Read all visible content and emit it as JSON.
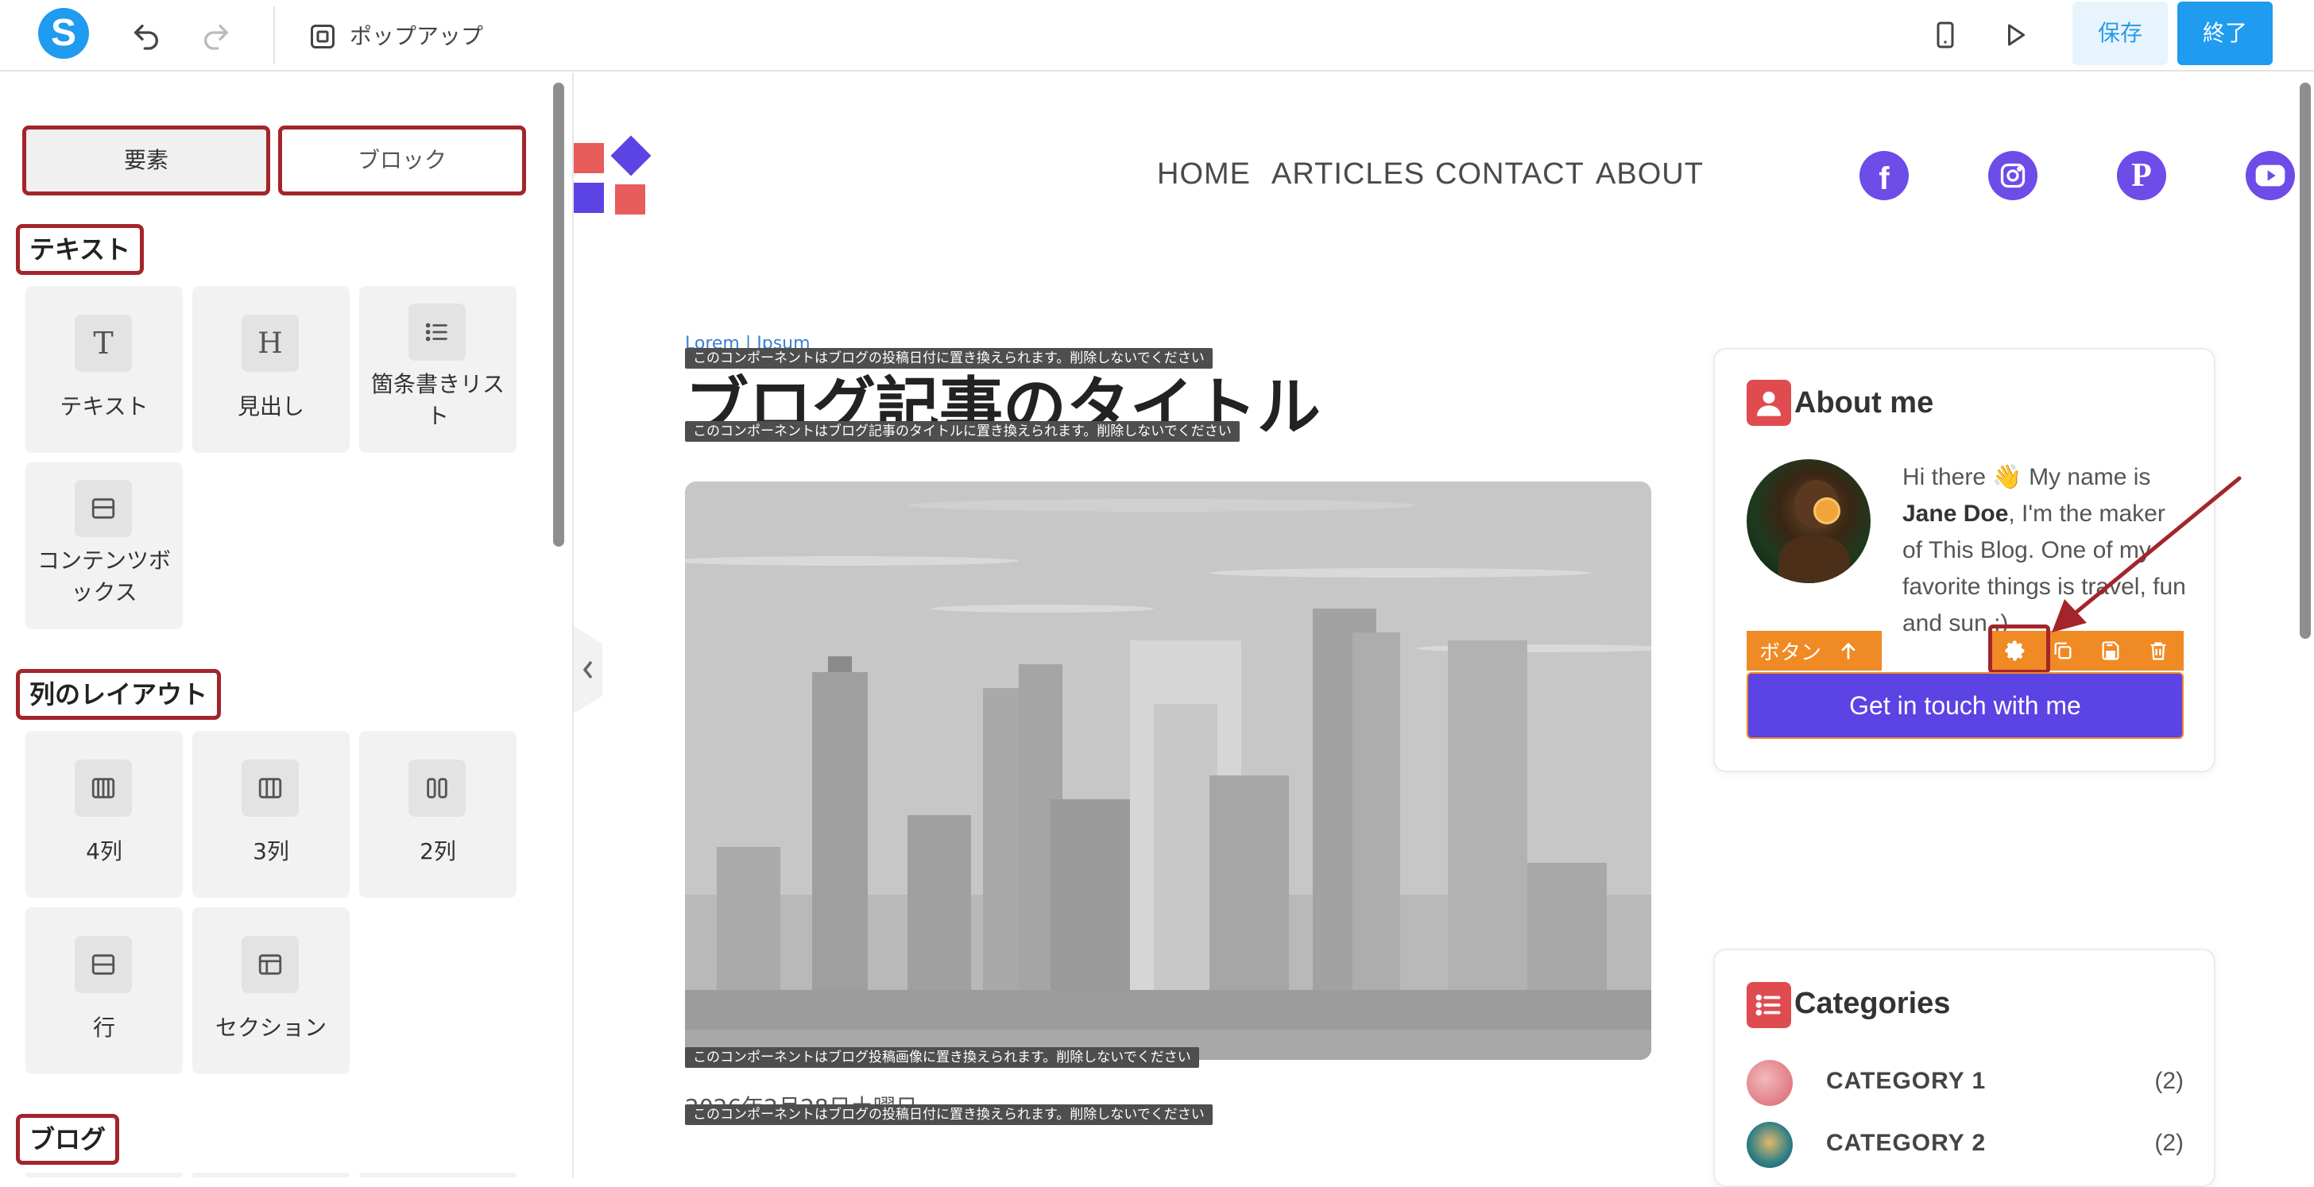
{
  "toolbar": {
    "logo_letter": "S",
    "popup_label": "ポップアップ",
    "save_label": "保存",
    "exit_label": "終了"
  },
  "sidebar": {
    "tabs": [
      "要素",
      "ブロック"
    ],
    "sections": {
      "text": {
        "heading": "テキスト",
        "items": [
          "テキスト",
          "見出し",
          "箇条書きリスト",
          "コンテンツボックス"
        ],
        "glyphs": [
          "T",
          "H"
        ]
      },
      "layout": {
        "heading": "列のレイアウト",
        "items": [
          "4列",
          "3列",
          "2列",
          "行",
          "セクション"
        ]
      },
      "blog": {
        "heading": "ブログ"
      }
    }
  },
  "canvas": {
    "nav": [
      "HOME",
      "ARTICLES",
      "CONTACT",
      "ABOUT"
    ],
    "social": [
      "facebook-icon",
      "instagram-icon",
      "pinterest-icon",
      "youtube-icon"
    ],
    "breadcrumb": "Lorem | Ipsum",
    "tags": {
      "date_top": "このコンポーネントはブログの投稿日付に置き換えられます。削除しないでください",
      "title": "このコンポーネントはブログ記事のタイトルに置き換えられます。削除しないでください",
      "image": "このコンポーネントはブログ投稿画像に置き換えられます。削除しないでください",
      "date_bottom": "このコンポーネントはブログの投稿日付に置き換えられます。削除しないでください"
    },
    "post_title": "ブログ記事のタイトル",
    "post_date": "2026年2月28日土曜日",
    "about": {
      "title": "About me",
      "bio_pre": "Hi there 👋 My name is ",
      "bio_name": "Jane Doe",
      "bio_post": ", I'm the maker of This Blog. One of my favorite things is travel, fun and sun :)",
      "element_label": "ボタン",
      "cta": "Get in touch with me"
    },
    "categories": {
      "title": "Categories",
      "items": [
        {
          "name": "CATEGORY 1",
          "count": "(2)"
        },
        {
          "name": "CATEGORY 2",
          "count": "(2)"
        }
      ]
    }
  },
  "colors": {
    "accent": "#1f9bf0",
    "brand_purple": "#5b43e4",
    "element_orange": "#f08a24",
    "highlight_red": "#a3252b",
    "logo_red": "#e85c5c"
  }
}
